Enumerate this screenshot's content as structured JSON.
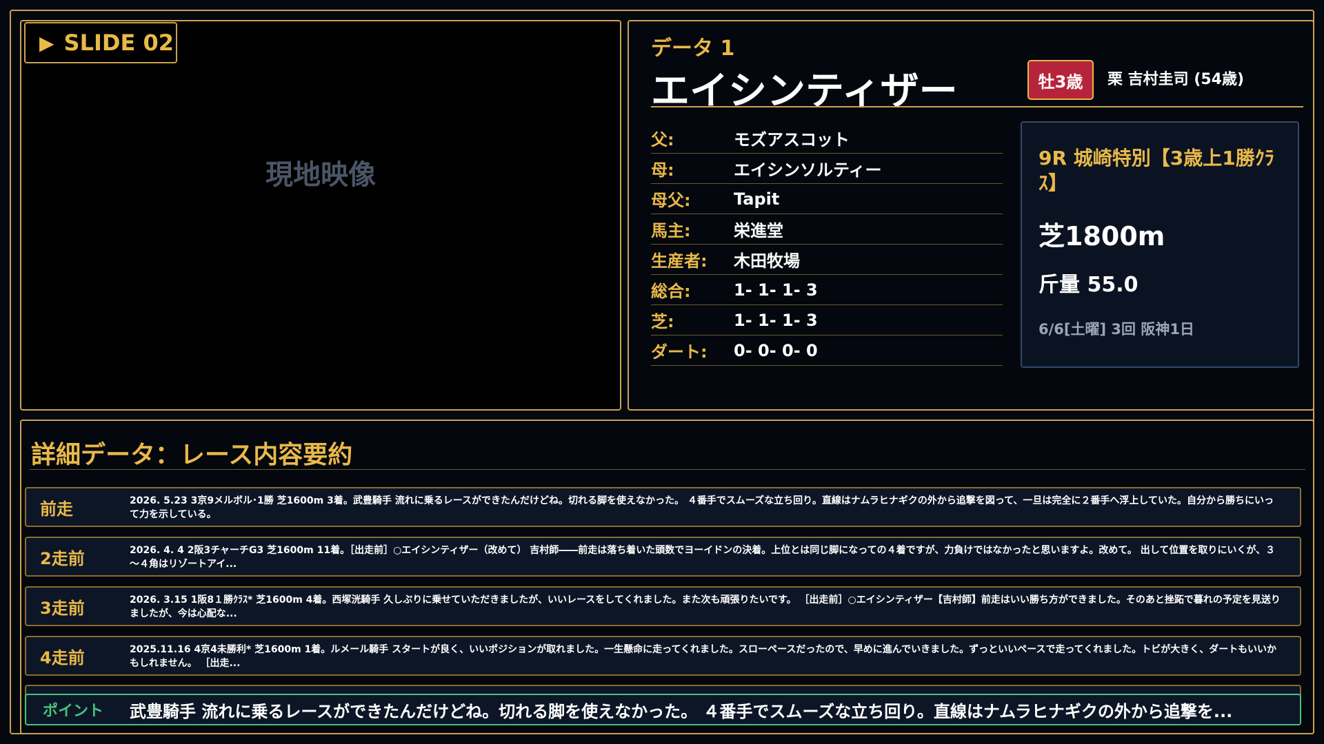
{
  "video": {
    "slide_label": "SLIDE 02",
    "play_icon": "▶",
    "placeholder": "現地映像"
  },
  "horse": {
    "data_label": "データ 1",
    "name": "エイシンティザー",
    "sex_age": "牡3歳",
    "jockey": "栗 吉村圭司 (54歳)",
    "pedigree": [
      {
        "key": "父:",
        "value": "モズアスコット"
      },
      {
        "key": "母:",
        "value": "エイシンソルティー"
      },
      {
        "key": "母父:",
        "value": "Tapit"
      },
      {
        "key": "馬主:",
        "value": "栄進堂"
      },
      {
        "key": "生産者:",
        "value": "木田牧場"
      },
      {
        "key": "総合:",
        "value": "1- 1- 1- 3"
      },
      {
        "key": "芝:",
        "value": "1- 1- 1- 3"
      },
      {
        "key": "ダート:",
        "value": "0- 0- 0- 0"
      }
    ]
  },
  "race": {
    "name": "9R 城崎特別【3歳上1勝ｸﾗｽ】",
    "distance": "芝1800m",
    "weight": "斤量 55.0",
    "date": "6/6[土曜] 3回 阪神1日"
  },
  "detail": {
    "title": "詳細データ：レース内容要約",
    "races": [
      {
        "label": "前走",
        "text": "2026. 5.23 3京9メルボル･1勝 芝1600m 3着。武豊騎手 流れに乗るレースができたんだけどね。切れる脚を使えなかった。 ４番手でスムーズな立ち回り。直線はナムラヒナギクの外から追撃を図って、一旦は完全に２番手へ浮上していた。自分から勝ちにいって力を示している。"
      },
      {
        "label": "2走前",
        "text": "2026. 4. 4 2阪3チャーチG3 芝1600m 11着。［出走前］○エイシンティザー（改めて） 吉村師――前走は落ち着いた頭数でヨーイドンの決着。上位とは同じ脚になっての４着ですが、力負けではなかったと思いますよ。改めて。 出して位置を取りにいくが、３～４角はリゾートアイ..."
      },
      {
        "label": "3走前",
        "text": "2026. 3.15 1阪8１勝ｸﾗｽ* 芝1600m 4着。西塚洸騎手 久しぶりに乗せていただきましたが、いいレースをしてくれました。また次も頑張りたいです。 ［出走前］○エイシンティザー【吉村師】前走はいい勝ち方ができました。そのあと挫跖で暮れの予定を見送りましたが、今は心配な..."
      },
      {
        "label": "4走前",
        "text": "2025.11.16 4京4未勝利* 芝1600m 1着。ルメール騎手 スタートが良く、いいポジションが取れました。一生懸命に走ってくれました。スローペースだったので、早めに進んでいきました。ずっといいペースで走ってくれました。トビが大きく、ダートもいいかもしれません。 ［出走..."
      }
    ],
    "point_label": "ポイント",
    "point_text": "武豊騎手 流れに乗るレースができたんだけどね。切れる脚を使えなかった。 ４番手でスムーズな立ち回り。直線はナムラヒナギクの外から追撃を..."
  }
}
